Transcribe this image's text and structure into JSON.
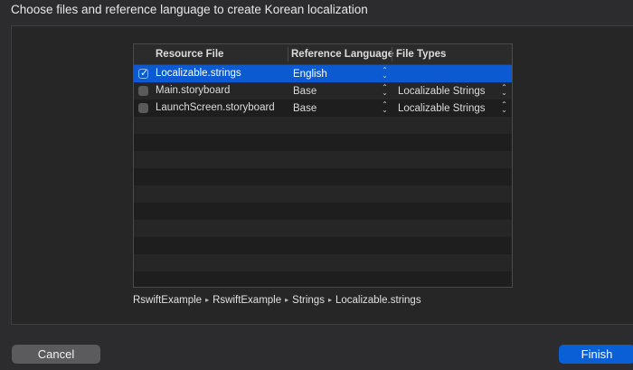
{
  "dialog": {
    "title": "Choose files and reference language to create Korean localization"
  },
  "table": {
    "headers": {
      "resource_file": "Resource File",
      "reference_language": "Reference Language",
      "file_types": "File Types"
    },
    "rows": [
      {
        "checked": true,
        "file": "Localizable.strings",
        "language": "English",
        "file_type": "",
        "selected": true
      },
      {
        "checked": false,
        "file": "Main.storyboard",
        "language": "Base",
        "file_type": "Localizable Strings",
        "selected": false
      },
      {
        "checked": false,
        "file": "LaunchScreen.storyboard",
        "language": "Base",
        "file_type": "Localizable Strings",
        "selected": false
      }
    ]
  },
  "path": [
    "RswiftExample",
    "RswiftExample",
    "Strings",
    "Localizable.strings"
  ],
  "buttons": {
    "cancel": "Cancel",
    "finish": "Finish"
  },
  "colors": {
    "accent": "#0b5fd6",
    "selected_row": "#0b5ad1",
    "background": "#2c2c2e"
  }
}
